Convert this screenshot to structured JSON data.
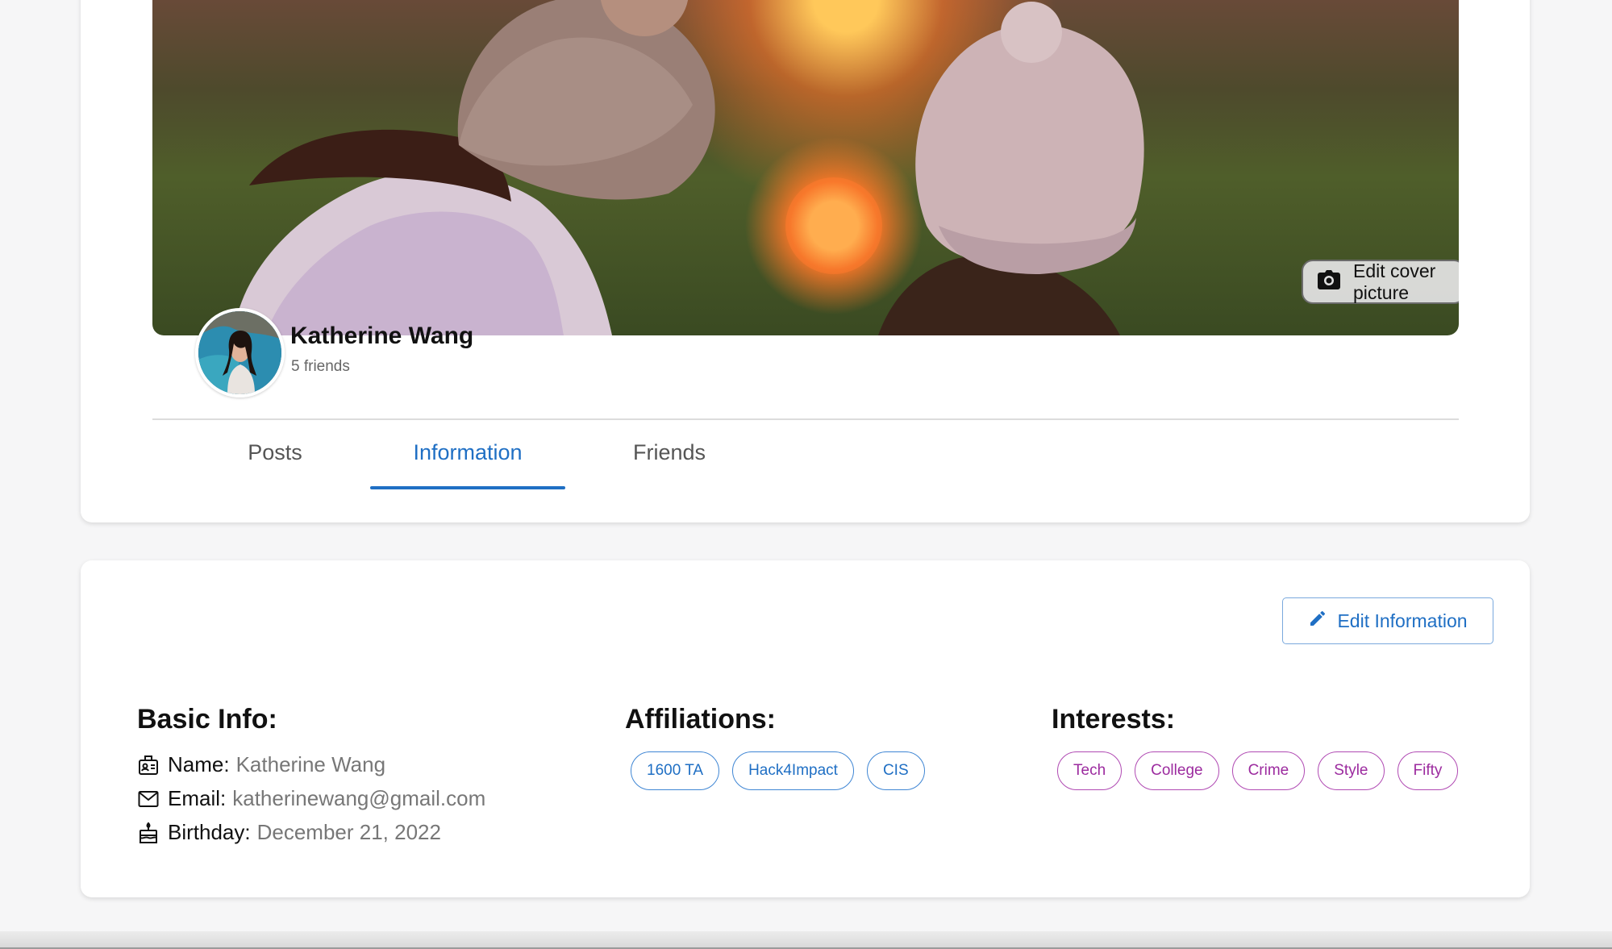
{
  "cover": {
    "edit_button_label": "Edit cover picture",
    "icon": "camera-icon"
  },
  "profile": {
    "name": "Katherine Wang",
    "friends_text": "5 friends"
  },
  "tabs": [
    {
      "label": "Posts",
      "active": false
    },
    {
      "label": "Information",
      "active": true
    },
    {
      "label": "Friends",
      "active": false
    }
  ],
  "info": {
    "edit_button_label": "Edit Information",
    "basic": {
      "title": "Basic Info:",
      "name_label": "Name:",
      "name_value": "Katherine Wang",
      "email_label": "Email:",
      "email_value": "katherinewang@gmail.com",
      "birthday_label": "Birthday:",
      "birthday_value": "December 21, 2022"
    },
    "affiliations": {
      "title": "Affiliations:",
      "items": [
        "1600 TA",
        "Hack4Impact",
        "CIS"
      ]
    },
    "interests": {
      "title": "Interests:",
      "items": [
        "Tech",
        "College",
        "Crime",
        "Style",
        "Fifty"
      ]
    }
  },
  "colors": {
    "accent": "#1f6fc4",
    "affiliation_chip": "#1f6fc4",
    "interest_chip": "#9c2b9f"
  }
}
